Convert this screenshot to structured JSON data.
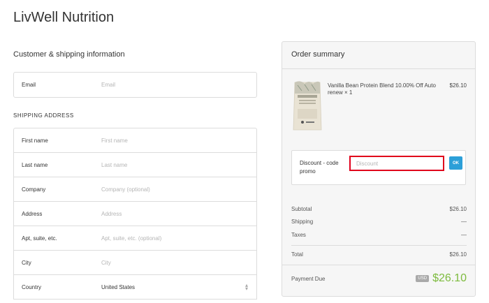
{
  "brand": "LivWell Nutrition",
  "customer_section": {
    "title": "Customer & shipping information",
    "email": {
      "label": "Email",
      "placeholder": "Email"
    }
  },
  "shipping": {
    "title": "SHIPPING ADDRESS",
    "fields": [
      {
        "label": "First name",
        "placeholder": "First name"
      },
      {
        "label": "Last name",
        "placeholder": "Last name"
      },
      {
        "label": "Company",
        "placeholder": "Company (optional)"
      },
      {
        "label": "Address",
        "placeholder": "Address"
      },
      {
        "label": "Apt, suite, etc.",
        "placeholder": "Apt, suite, etc. (optional)"
      },
      {
        "label": "City",
        "placeholder": "City"
      }
    ],
    "country": {
      "label": "Country",
      "value": "United States"
    }
  },
  "summary": {
    "title": "Order summary",
    "product": {
      "name": "Vanilla Bean Protein Blend 10.00% Off Auto renew × 1",
      "price": "$26.10",
      "image_icon": "protein-pouch-icon"
    },
    "discount": {
      "label": "Discount - code promo",
      "placeholder": "Discount",
      "button": "OK"
    },
    "rows": [
      {
        "label": "Subtotal",
        "value": "$26.10"
      },
      {
        "label": "Shipping",
        "value": "—"
      },
      {
        "label": "Taxes",
        "value": "—"
      }
    ],
    "total": {
      "label": "Total",
      "value": "$26.10"
    },
    "payment_due": {
      "label": "Payment Due",
      "currency": "USD",
      "amount": "$26.10"
    }
  },
  "colors": {
    "accent": "#2c9fd8",
    "highlight_border": "#e0001b",
    "due_amount": "#7dbb3e"
  }
}
